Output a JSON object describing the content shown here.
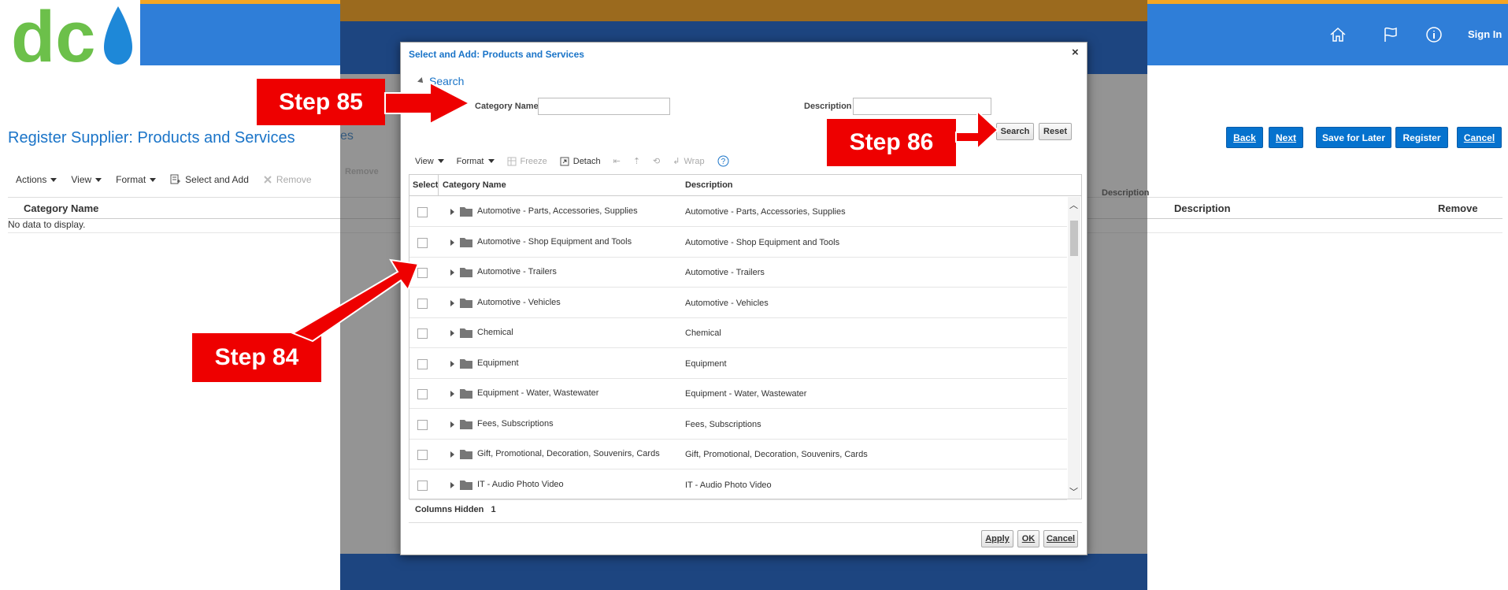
{
  "header": {
    "signin_label": "Sign In",
    "icons": [
      "home-icon",
      "flag-icon",
      "info-icon"
    ],
    "brand_colors": {
      "blue": "#2f7ed8",
      "green": "#6cc04a",
      "drop": "#1e88d8"
    },
    "logo_text": "dc"
  },
  "page": {
    "title": "Register Supplier: Products and Services",
    "title_tail": "es",
    "buttons": {
      "back": "Back",
      "next": "Next",
      "save": "Save for Later",
      "register": "Register",
      "cancel": "Cancel"
    },
    "toolbar": {
      "actions": "Actions",
      "view": "View",
      "format": "Format",
      "select_add": "Select and Add",
      "remove": "Remove"
    },
    "bg_labels": {
      "remove": "Remove",
      "description": "Description"
    },
    "columns": {
      "category": "Category Name",
      "description": "Description",
      "remove": "Remove"
    },
    "no_data": "No data to display."
  },
  "dialog": {
    "title": "Select and Add: Products and Services",
    "close": "×",
    "search_heading": "Search",
    "category_label": "Category Name",
    "description_label": "Description",
    "search_btn": "Search",
    "reset_btn": "Reset",
    "toolbar": {
      "view": "View",
      "format": "Format",
      "freeze": "Freeze",
      "detach": "Detach",
      "wrap": "Wrap"
    },
    "columns": {
      "select": "Select",
      "category": "Category Name",
      "description": "Description"
    },
    "rows": [
      {
        "name": "Automotive - Parts, Accessories, Supplies",
        "desc": "Automotive - Parts, Accessories, Supplies"
      },
      {
        "name": "Automotive - Shop Equipment and Tools",
        "desc": "Automotive - Shop Equipment and Tools"
      },
      {
        "name": "Automotive - Trailers",
        "desc": "Automotive - Trailers"
      },
      {
        "name": "Automotive - Vehicles",
        "desc": "Automotive - Vehicles"
      },
      {
        "name": "Chemical",
        "desc": "Chemical"
      },
      {
        "name": "Equipment",
        "desc": "Equipment"
      },
      {
        "name": "Equipment - Water, Wastewater",
        "desc": "Equipment - Water, Wastewater"
      },
      {
        "name": "Fees, Subscriptions",
        "desc": "Fees, Subscriptions"
      },
      {
        "name": "Gift, Promotional, Decoration, Souvenirs, Cards",
        "desc": "Gift, Promotional, Decoration, Souvenirs, Cards"
      },
      {
        "name": "IT - Audio Photo Video",
        "desc": "IT - Audio Photo Video"
      }
    ],
    "columns_hidden_label": "Columns Hidden",
    "columns_hidden_count": "1",
    "apply_btn": "Apply",
    "ok_btn": "OK",
    "cancel_btn": "Cancel"
  },
  "callouts": {
    "step85": "Step 85",
    "step86": "Step 86",
    "step84": "Step 84",
    "color": "#ee0000"
  }
}
